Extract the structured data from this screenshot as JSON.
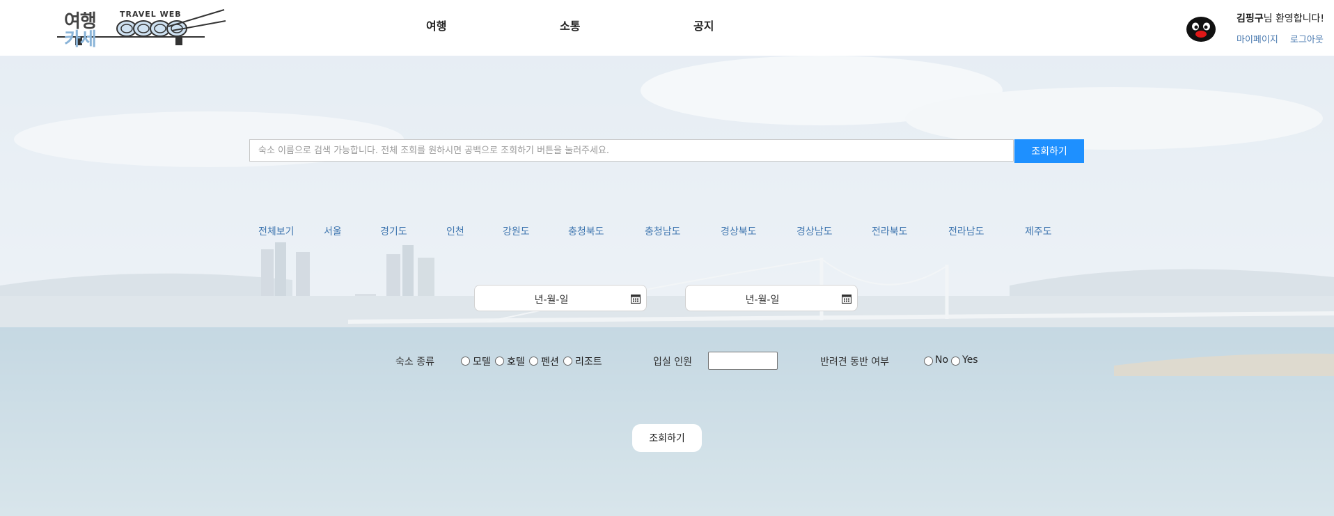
{
  "header": {
    "logo": {
      "ko_line1": "여행",
      "ko_line2": "카세",
      "en": "TRAVEL WEB"
    },
    "nav": [
      {
        "label": "여행"
      },
      {
        "label": "소통"
      },
      {
        "label": "공지"
      }
    ],
    "user": {
      "name": "김핑구",
      "greeting_suffix": "님 환영합니다!",
      "mypage_label": "마이페이지",
      "logout_label": "로그아웃"
    }
  },
  "search": {
    "placeholder": "숙소 이름으로 검색 가능합니다. 전체 조회를 원하시면 공백으로 조회하기 버튼을 눌러주세요.",
    "value": "",
    "button_label": "조회하기"
  },
  "regions": [
    {
      "label": "전체보기"
    },
    {
      "label": "서울"
    },
    {
      "label": "경기도"
    },
    {
      "label": "인천"
    },
    {
      "label": "강원도"
    },
    {
      "label": "충청북도"
    },
    {
      "label": "충청남도"
    },
    {
      "label": "경상북도"
    },
    {
      "label": "경상남도"
    },
    {
      "label": "전라북도"
    },
    {
      "label": "전라남도"
    },
    {
      "label": "제주도"
    }
  ],
  "dates": {
    "checkin_text": "년-월-일",
    "checkout_text": "년-월-일",
    "icon": "calendar-icon"
  },
  "filters": {
    "type_label": "숙소 종류",
    "type_options": [
      {
        "label": "모텔"
      },
      {
        "label": "호텔"
      },
      {
        "label": "펜션"
      },
      {
        "label": "리조트"
      }
    ],
    "guests_label": "입실 인원",
    "guests_value": "",
    "pet_label": "반려견 동반 여부",
    "pet_options": [
      {
        "label": "No"
      },
      {
        "label": "Yes"
      }
    ]
  },
  "submit": {
    "label": "조회하기"
  },
  "colors": {
    "accent": "#1e90ff",
    "region_link": "#3f76b0",
    "header_link": "#4a7ab0"
  }
}
